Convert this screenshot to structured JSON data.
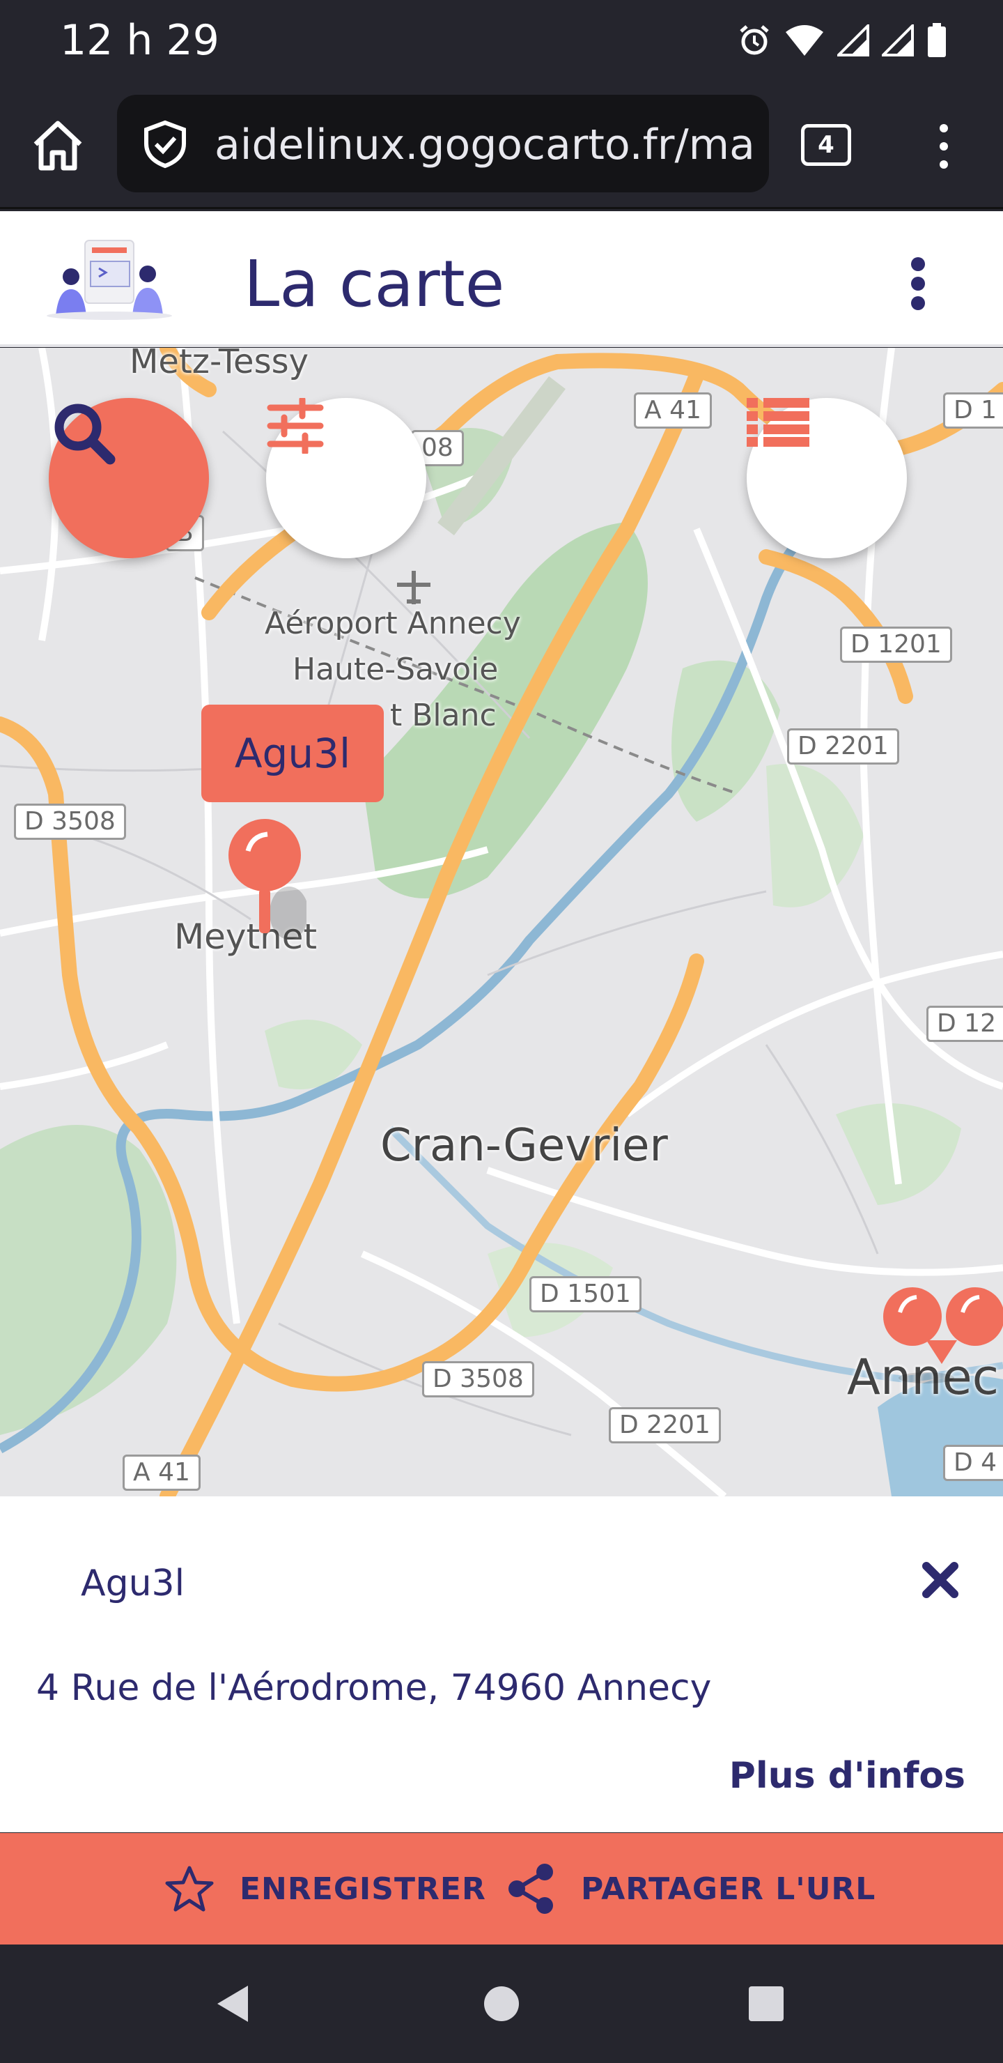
{
  "status_bar": {
    "time": "12 h 29"
  },
  "browser": {
    "url": "aidelinux.gogocarto.fr/ma",
    "tab_count": "4"
  },
  "app": {
    "title": "La carte"
  },
  "map": {
    "marker_label": "Agu3l",
    "places": {
      "metz_tessy": "Metz-Tessy",
      "airport_1": "Aéroport Annecy",
      "airport_2": "Haute-Savoie",
      "airport_3": "t Blanc",
      "meythet": "Meythet",
      "cran_gevrier": "Cran-Gevrier",
      "annecy": "Annec"
    },
    "roads": {
      "a41_top": "A 41",
      "a41_bottom": "A 41",
      "d08": "08",
      "d1_right": "D 1",
      "d1201": "D 1201",
      "d2201_top": "D 2201",
      "d3508_left": "D 3508",
      "d12_right": "D 12",
      "d1501": "D 1501",
      "d3508_bottom": "D 3508",
      "d2201_bottom": "D 2201",
      "d4_right": "D 4",
      "b_left": "B"
    }
  },
  "sheet": {
    "name": "Agu3l",
    "address": "4 Rue de l'Aérodrome, 74960 Annecy",
    "more_link": "Plus d'infos"
  },
  "actions": {
    "save_label": "ENREGISTRER",
    "share_label": "PARTAGER L'URL"
  },
  "colors": {
    "accent": "#f16f5c",
    "primary": "#2d2a6e",
    "system_bar": "#25252d"
  }
}
